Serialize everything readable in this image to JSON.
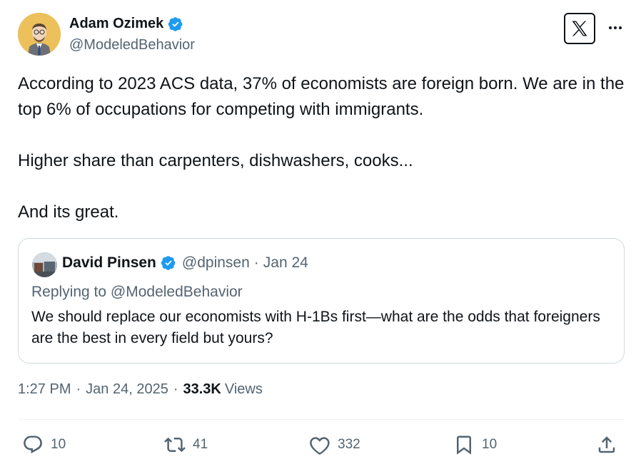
{
  "author": {
    "name": "Adam Ozimek",
    "handle": "@ModeledBehavior"
  },
  "tweet": {
    "paragraphs": [
      "According to 2023 ACS data, 37% of economists are foreign born. We are in the top 6% of occupations for competing with immigrants.",
      "Higher share than carpenters, dishwashers, cooks...",
      "And its great."
    ]
  },
  "quote": {
    "name": "David Pinsen",
    "handle": "@dpinsen",
    "date": "Jan 24",
    "replying_to": "Replying to @ModeledBehavior",
    "body": "We should replace our economists with H-1Bs first—what are the odds that foreigners are the best in every field but yours?"
  },
  "meta": {
    "time": "1:27 PM",
    "date": "Jan 24, 2025",
    "views_count": "33.3K",
    "views_label": "Views"
  },
  "actions": {
    "replies": "10",
    "reposts": "41",
    "likes": "332",
    "bookmarks": "10"
  },
  "colors": {
    "verified": "#1d9bf0",
    "text": "#0f1419",
    "secondary": "#536471",
    "border": "#cfd9de"
  },
  "icons": {
    "verified": "verified-badge-icon",
    "brand": "x-logo-icon",
    "more": "more-horizontal-icon",
    "reply": "reply-icon",
    "repost": "repost-icon",
    "like": "heart-icon",
    "bookmark": "bookmark-icon",
    "share": "share-icon"
  }
}
